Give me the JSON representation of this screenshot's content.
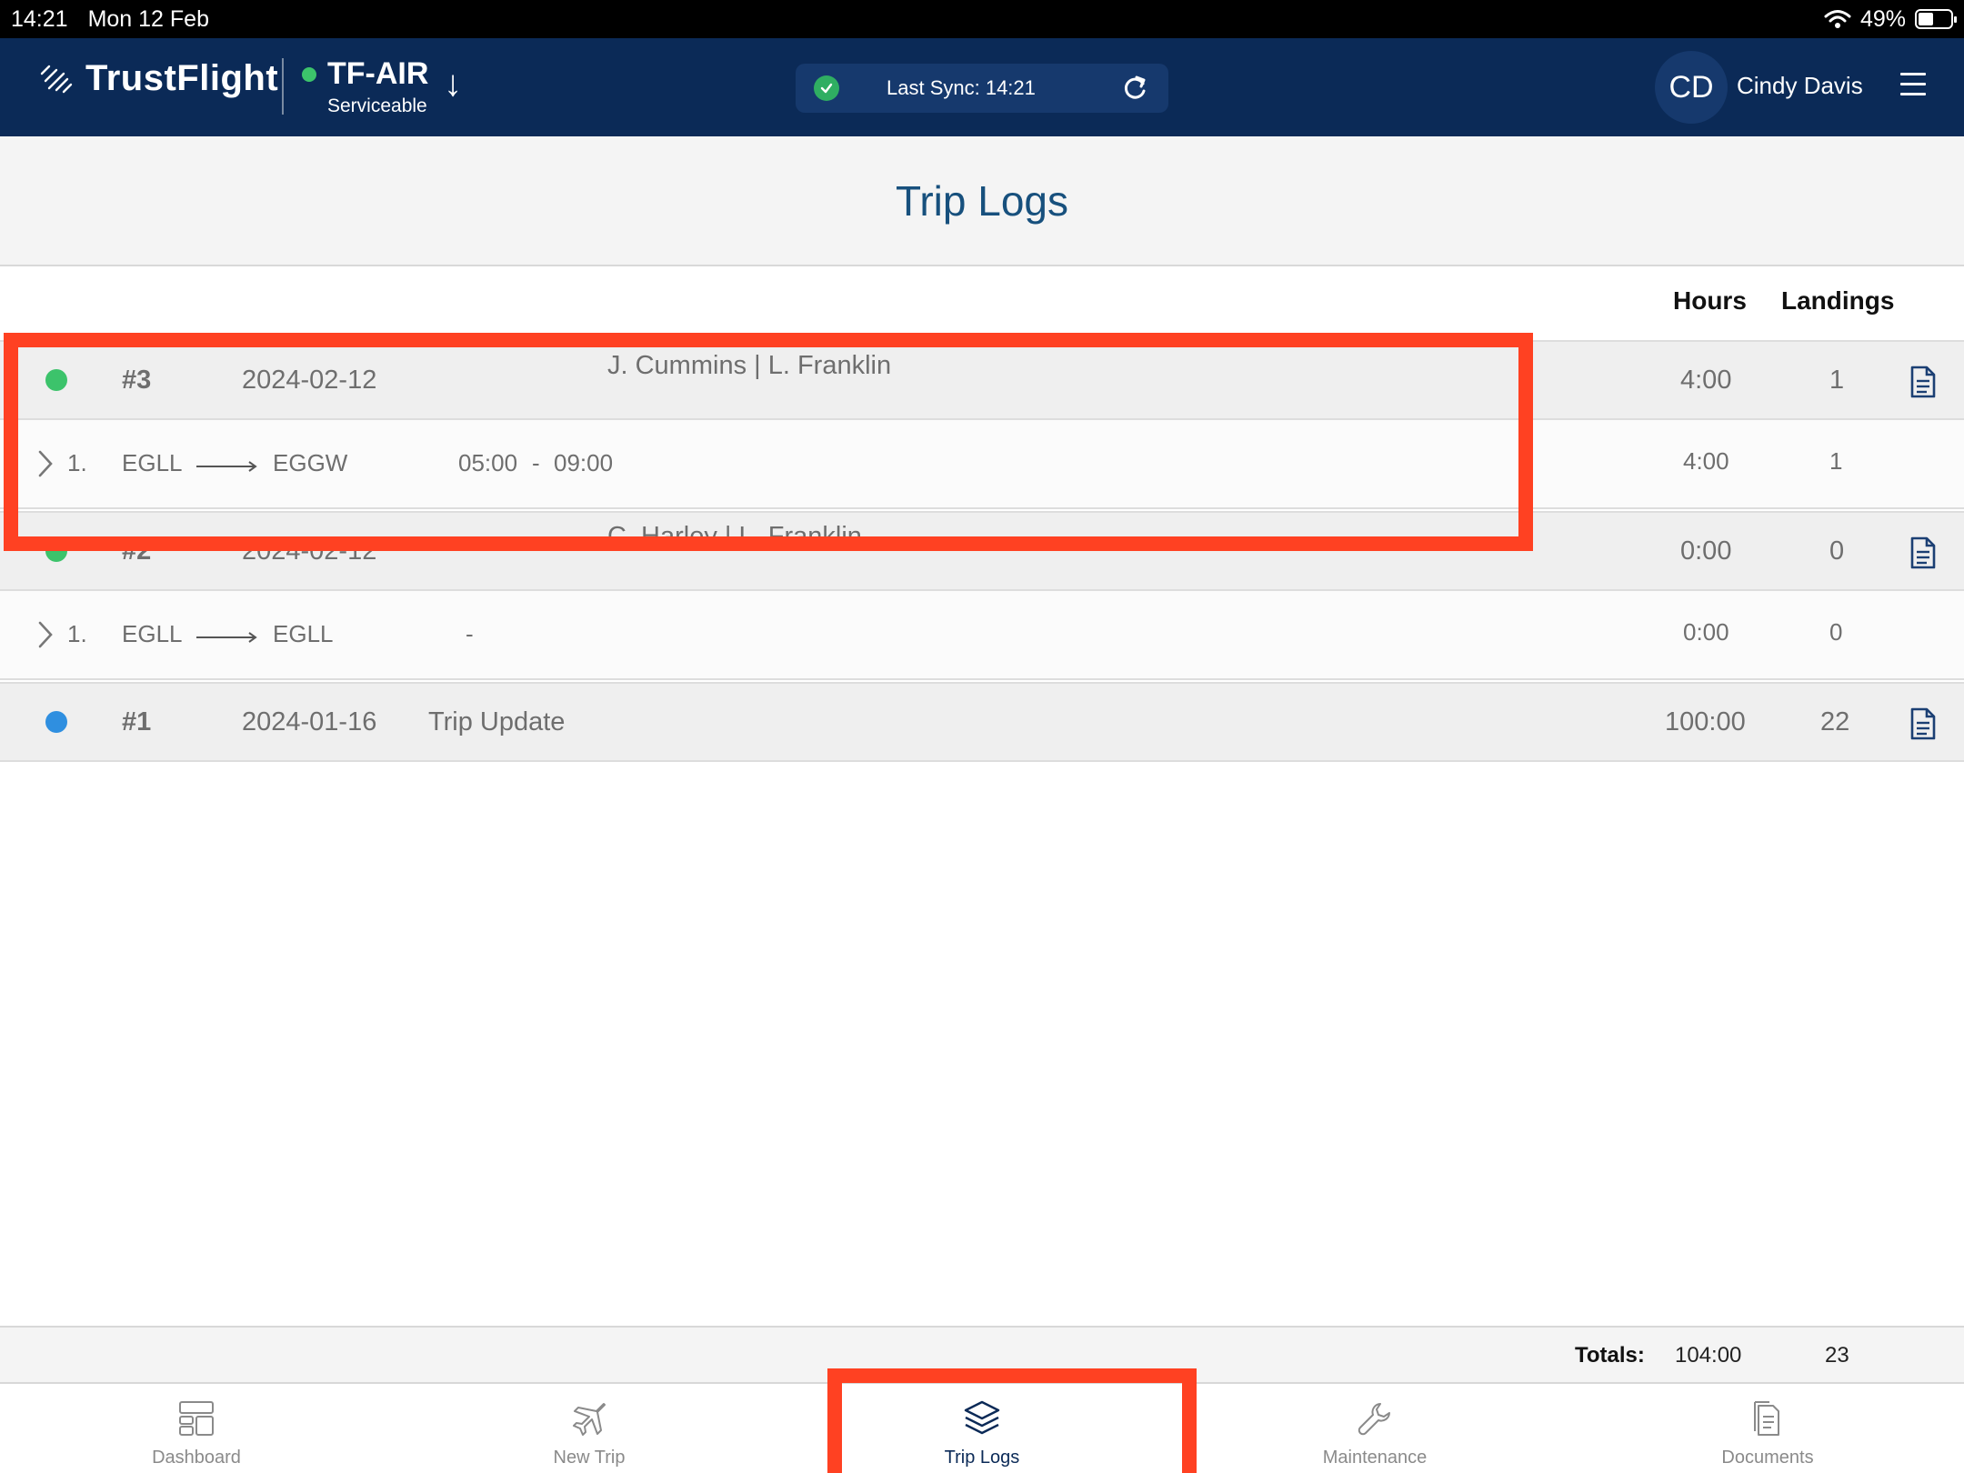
{
  "status_bar": {
    "time": "14:21",
    "date": "Mon 12 Feb",
    "battery": "49%"
  },
  "header": {
    "brand": "TrustFlight",
    "aircraft": "TF-AIR",
    "aircraft_status": "Serviceable",
    "aircraft_arrow": "↓",
    "sync_text": "Last Sync: 14:21",
    "user_initials": "CD",
    "user_name": "Cindy Davis"
  },
  "page": {
    "title": "Trip Logs"
  },
  "columns": {
    "hours": "Hours",
    "landings": "Landings"
  },
  "trips": [
    {
      "number": "#3",
      "date": "2024-02-12",
      "crew": "J. Cummins | L. Franklin",
      "status_color": "#3cc36b",
      "hours": "4:00",
      "landings": "1",
      "legs": [
        {
          "index": "1.",
          "from": "EGLL",
          "to": "EGGW",
          "start": "05:00",
          "separator": "-",
          "end": "09:00",
          "hours": "4:00",
          "landings": "1"
        }
      ]
    },
    {
      "number": "#2",
      "date": "2024-02-12",
      "crew": "C. Harley | L. Franklin",
      "status_color": "#3cc36b",
      "hours": "0:00",
      "landings": "0",
      "legs": [
        {
          "index": "1.",
          "from": "EGLL",
          "to": "EGLL",
          "start": "",
          "separator": "-",
          "end": "",
          "hours": "0:00",
          "landings": "0"
        }
      ]
    },
    {
      "number": "#1",
      "date": "2024-01-16",
      "crew": "Trip Update",
      "status_color": "#2f8fe0",
      "hours": "100:00",
      "landings": "22",
      "legs": []
    }
  ],
  "totals": {
    "label": "Totals:",
    "hours": "104:00",
    "landings": "23"
  },
  "tabs": [
    {
      "label": "Dashboard",
      "icon": "dashboard-icon"
    },
    {
      "label": "New Trip",
      "icon": "airplane-icon"
    },
    {
      "label": "Trip Logs",
      "icon": "layers-icon",
      "active": true
    },
    {
      "label": "Maintenance",
      "icon": "wrench-icon"
    },
    {
      "label": "Documents",
      "icon": "documents-icon"
    }
  ],
  "colors": {
    "header": "#0b2a57",
    "accent": "#17507d",
    "highlight": "#ff4122"
  }
}
